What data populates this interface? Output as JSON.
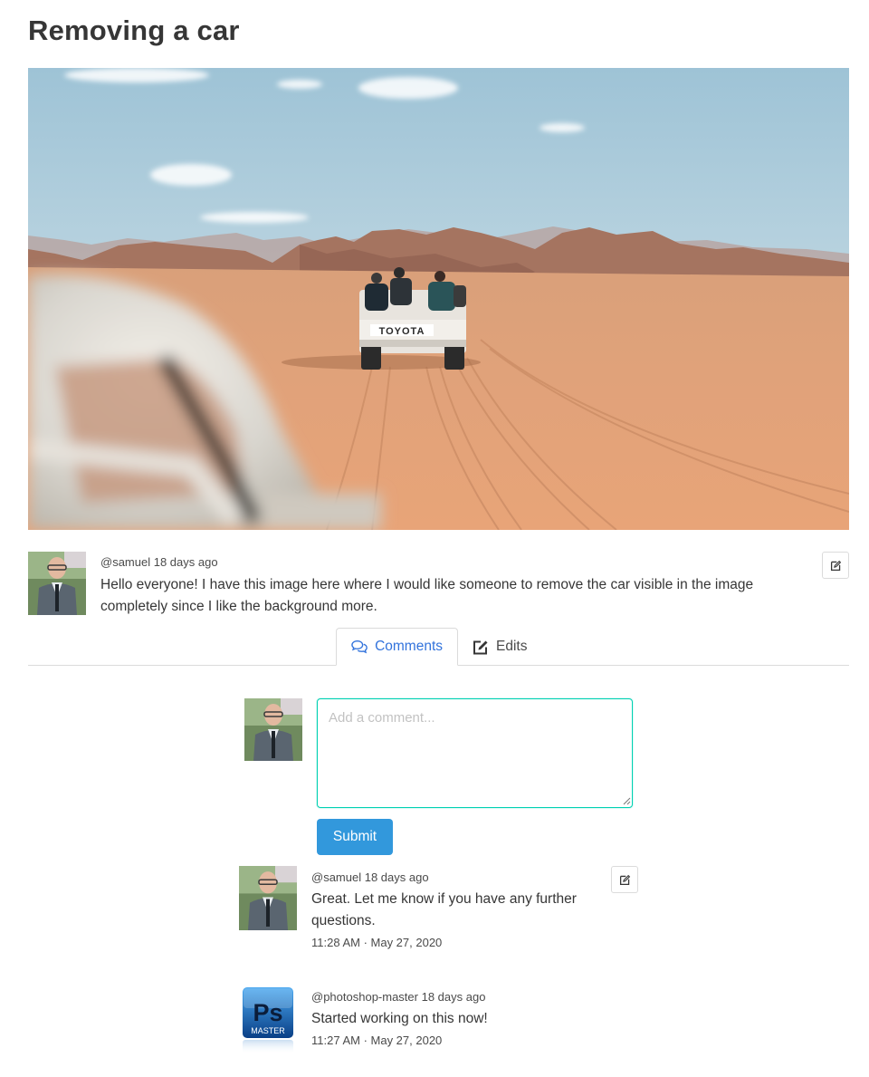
{
  "page": {
    "title": "Removing a car"
  },
  "hero": {
    "alt_text": "TOYOTA"
  },
  "post": {
    "username": "@samuel",
    "age": "18 days ago",
    "body": "Hello everyone! I have this image here where I would like someone to remove the car visible in the image completely since I like the background more.",
    "edit_icon": "edit-icon"
  },
  "tabs": [
    {
      "label": "Comments",
      "icon": "comments-icon",
      "active": true
    },
    {
      "label": "Edits",
      "icon": "edit-square-icon",
      "active": false
    }
  ],
  "comment_form": {
    "placeholder": "Add a comment...",
    "value": "",
    "submit_label": "Submit"
  },
  "comments": [
    {
      "username": "@samuel",
      "age": "18 days ago",
      "body": "Great. Let me know if you have any further questions.",
      "timestamp": "11:28 AM · May 27, 2020",
      "avatar": "person-avatar",
      "editable": true
    },
    {
      "username": "@photoshop-master",
      "age": "18 days ago",
      "body": "Started working on this now!",
      "timestamp": "11:27 AM · May 27, 2020",
      "avatar": "photoshop-logo-avatar",
      "logo_text": "Ps",
      "logo_subtext": "MASTER"
    }
  ],
  "colors": {
    "link": "#3273dc",
    "primary_button": "#3298dc",
    "focus_border": "#00d1b2",
    "border": "#dbdbdb"
  }
}
